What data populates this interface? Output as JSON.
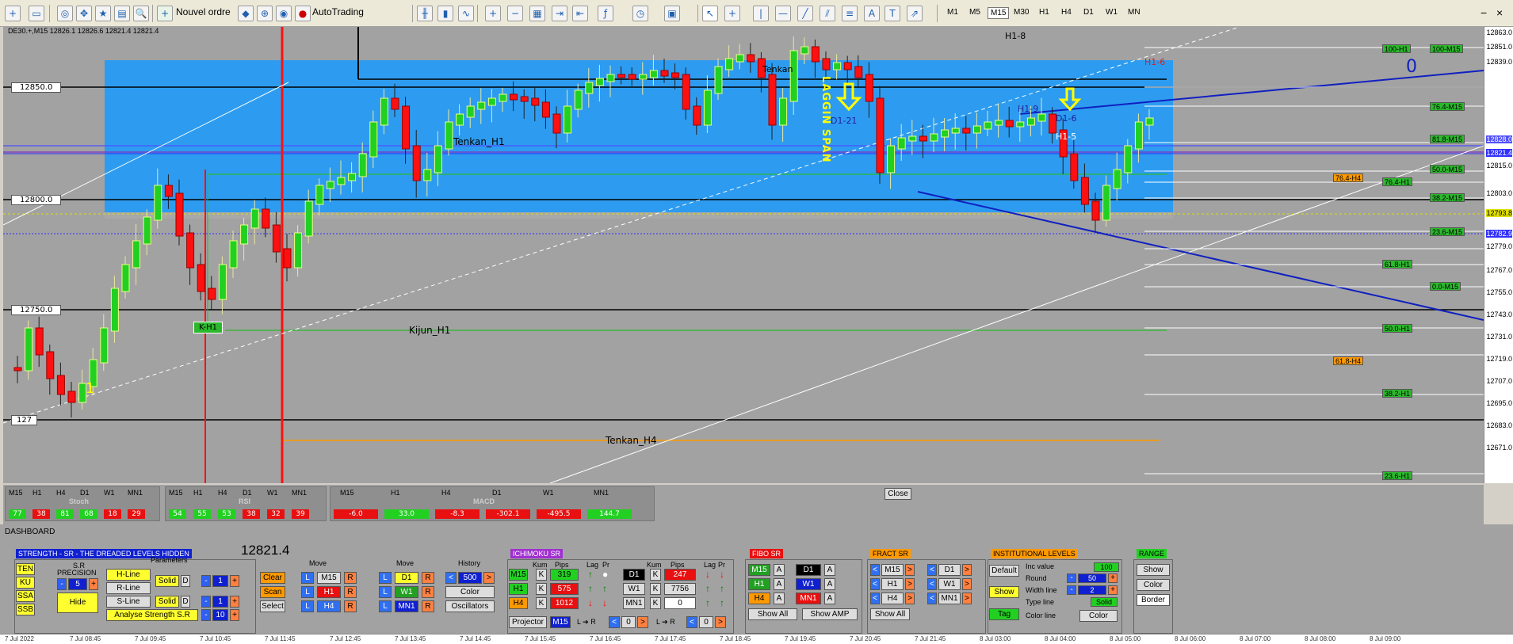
{
  "toolbar": {
    "new_order": "Nouvel ordre",
    "autotrading": "AutoTrading",
    "timeframes": [
      "M1",
      "M5",
      "M15",
      "M30",
      "H1",
      "H4",
      "D1",
      "W1",
      "MN"
    ],
    "active_tf": "M15"
  },
  "chart": {
    "symbol_info": "DE30.+,M15  12826.1 12826.6 12821.4 12821.4",
    "labels": {
      "h1_8": "H1-8",
      "lagging": "LAGGIN SPAN",
      "tenkan_top": "Tenkan",
      "d1_21": "D1-21",
      "h1_9": "H1-9",
      "d1_6": "D1-6",
      "h1_5": "H1-5",
      "h1_6": "H1-6",
      "zero": "0",
      "tenkan_h1": "Tenkan_H1",
      "kijun_h1": "Kijun_H1",
      "k_h1": "K-H1",
      "tenkan_h4": "Tenkan_H4",
      "one": "1"
    },
    "left_prices": [
      "12850.0",
      "12800.0",
      "12750.0",
      "127"
    ],
    "levels": [
      "100-H1",
      "100-M15",
      "76.4-M15",
      "81.8-M15",
      "50.0-M15",
      "76.4-H4",
      "76.4-H1",
      "38.2-M15",
      "23.6-M15",
      "61.8-H1",
      "0.0-M15",
      "50.0-H1",
      "61.8-H4",
      "38.2-H1",
      "23.6-H1"
    ],
    "price_scale": [
      "12863.0",
      "12851.0",
      "12839.0",
      "12828.0",
      "12821.4",
      "12815.0",
      "12803.0",
      "12793.8",
      "12782.9",
      "12779.0",
      "12767.0",
      "12755.0",
      "12743.0",
      "12731.0",
      "12719.0",
      "12707.0",
      "12695.0",
      "12683.0",
      "12671.0"
    ]
  },
  "indicators": {
    "stoch": {
      "title": "Stoch",
      "tfs": [
        "M15",
        "H1",
        "H4",
        "D1",
        "W1",
        "MN1"
      ],
      "values": [
        "77",
        "38",
        "81",
        "68",
        "18",
        "29"
      ]
    },
    "rsi": {
      "title": "RSI",
      "tfs": [
        "M15",
        "H1",
        "H4",
        "D1",
        "W1",
        "MN1"
      ],
      "values": [
        "54",
        "55",
        "53",
        "38",
        "32",
        "39"
      ]
    },
    "macd": {
      "title": "MACD",
      "tfs": [
        "M15",
        "H1",
        "H4",
        "D1",
        "W1",
        "MN1"
      ],
      "values": [
        "-6.0",
        "33.0",
        "-8.3",
        "-302.1",
        "-495.5",
        "144.7"
      ]
    },
    "close": "Close"
  },
  "dashboard": {
    "title": "DASHBOARD",
    "price": "12821.4",
    "strength": {
      "title": "STRENGTH - SR - THE DREADED LEVELS HIDDEN",
      "ten": "TEN",
      "ku": "KU",
      "ssa": "SSA",
      "ssb": "SSB",
      "sr": "S.R",
      "precision": "PRECISION",
      "precision_val": "5",
      "hide": "Hide",
      "params": "Parameters",
      "hline": "H-Line",
      "rline": "R-Line",
      "sline": "S-Line",
      "solid": "Solid",
      "d": "D",
      "one": "1",
      "ten_val": "10",
      "analyse": "Analyse Strength S.R"
    },
    "move": {
      "move": "Move",
      "history": "History",
      "clear": "Clear",
      "scan": "Scan",
      "select": "Select",
      "l": "L",
      "r": "R",
      "m15": "M15",
      "h1": "H1",
      "h4": "H4",
      "d1": "D1",
      "w1": "W1",
      "mn1": "MN1",
      "hist_val": "500",
      "color": "Color",
      "osc": "Oscillators"
    },
    "ichimoku": {
      "title": "ICHIMOKU SR",
      "kum": "Kum",
      "pips": "Pips",
      "lag": "Lag",
      "pr": "Pr",
      "rows_left": [
        {
          "tf": "M15",
          "pips": "319"
        },
        {
          "tf": "H1",
          "pips": "575"
        },
        {
          "tf": "H4",
          "pips": "1012"
        }
      ],
      "rows_right": [
        {
          "tf": "D1",
          "pips": "247"
        },
        {
          "tf": "W1",
          "pips": "7756"
        },
        {
          "tf": "MN1",
          "pips": "0"
        }
      ],
      "projector": "Projector",
      "proj_tf": "M15",
      "lr": "L",
      "r": "R",
      "zero": "0"
    },
    "fibo": {
      "title": "FIBO SR",
      "m15": "M15",
      "h1": "H1",
      "h4": "H4",
      "d1": "D1",
      "w1": "W1",
      "mn1": "MN1",
      "a": "A",
      "show_all": "Show All",
      "show_amp": "Show AMP"
    },
    "fract": {
      "title": "FRACT SR",
      "m15": "M15",
      "h1": "H1",
      "h4": "H4",
      "d1": "D1",
      "w1": "W1",
      "mn1": "MN1",
      "show_all": "Show All"
    },
    "inst": {
      "title": "INSTITUTIONAL LEVELS",
      "default": "Default",
      "show": "Show",
      "tag": "Tag",
      "inc": "Inc value",
      "inc_val": "100",
      "round": "Round",
      "round_val": "50",
      "width": "Width line",
      "width_val": "2",
      "type": "Type line",
      "type_val": "Solid",
      "colorline": "Color line",
      "color": "Color"
    },
    "range": {
      "title": "RANGE",
      "show": "Show",
      "color": "Color",
      "border": "Border"
    }
  },
  "dates": [
    "7 Jul 2022",
    "7 Jul 08:45",
    "7 Jul 09:45",
    "7 Jul 10:45",
    "7 Jul 11:45",
    "7 Jul 12:45",
    "7 Jul 13:45",
    "7 Jul 14:45",
    "7 Jul 15:45",
    "7 Jul 16:45",
    "7 Jul 17:45",
    "7 Jul 18:45",
    "7 Jul 19:45",
    "7 Jul 20:45",
    "7 Jul 21:45",
    "8 Jul 03:00",
    "8 Jul 04:00",
    "8 Jul 05:00",
    "8 Jul 06:00",
    "8 Jul 07:00",
    "8 Jul 08:00",
    "8 Jul 09:00"
  ]
}
